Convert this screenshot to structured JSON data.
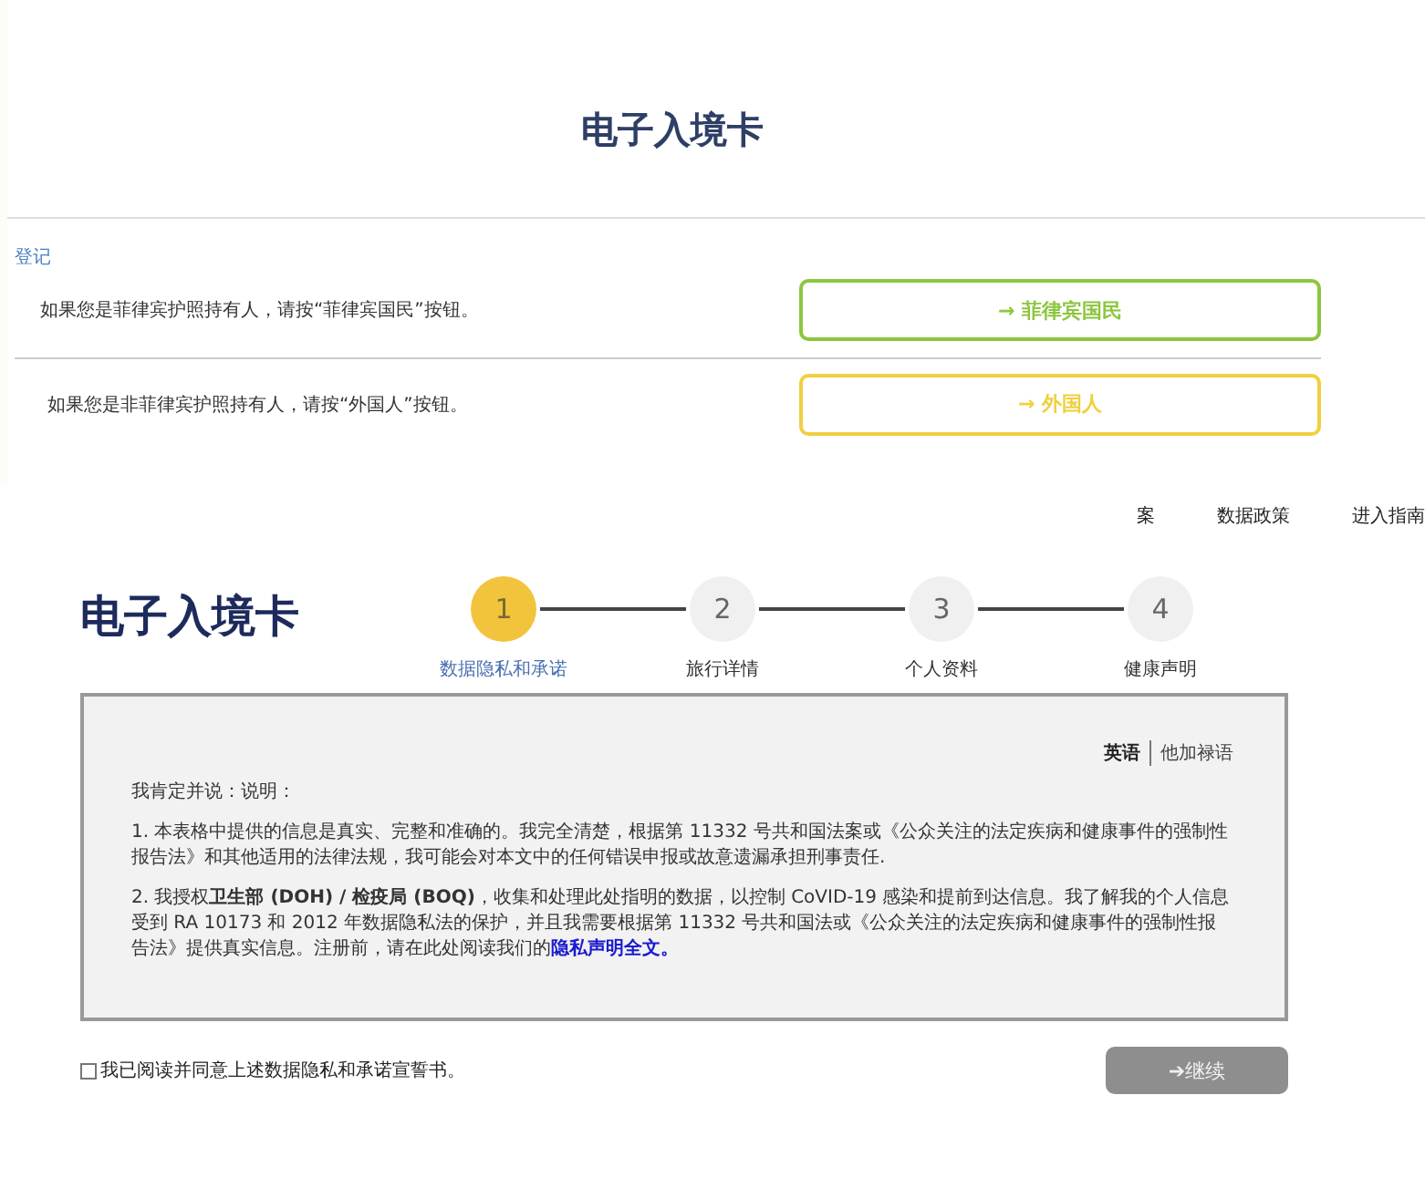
{
  "registration": {
    "title": "电子入境卡",
    "section_label": "登记",
    "options": [
      {
        "text": "如果您是菲律宾护照持有人，请按“菲律宾国民”按钮。",
        "button": "→ 菲律宾国民",
        "color": "#8cc63f"
      },
      {
        "text": "如果您是非菲律宾护照持有人，请按“外国人”按钮。",
        "button": "→ 外国人",
        "color": "#f0d040"
      }
    ]
  },
  "form": {
    "nav": [
      "案",
      "数据政策",
      "进入指南"
    ],
    "title": "电子入境卡",
    "steps": [
      {
        "number": "1",
        "label": "数据隐私和承诺",
        "selected": true
      },
      {
        "number": "2",
        "label": "旅行详情",
        "selected": false
      },
      {
        "number": "3",
        "label": "个人资料",
        "selected": false
      },
      {
        "number": "4",
        "label": "健康声明",
        "selected": false
      }
    ],
    "languages": [
      {
        "label": "英语",
        "selected": true
      },
      {
        "label": "他加禄语",
        "selected": false
      }
    ],
    "intro": "我肯定并说：说明：",
    "paragraphs": [
      {
        "text": "1. 本表格中提供的信息是真实、完整和准确的。我完全清楚，根据第 11332 号共和国法案或《公众关注的法定疾病和健康事件的强制性报告法》和其他适用的法律法规，我可能会对本文中的任何错误申报或故意遗漏承担刑事责任."
      },
      {
        "text": "2. 我授权**卫生部 (DOH) / 检疫局 (BOQ)**，收集和处理此处指明的数据，以控制 CoVID-19 感染和提前到达信息。我了解我的个人信息受到 RA 10173 和 2012 年数据隐私法的保护，并且我需要根据第 11332 号共和国法或《公众关注的法定疾病和健康事件的强制性报告法》提供真实信息。注册前，请在此处阅读我们的",
        "link": "隐私声明全文。"
      }
    ],
    "agreement": {
      "label": "我已阅读并同意上述数据隐私和承诺宣誓书。",
      "checked": false
    },
    "continue_button": {
      "label": "➔继续",
      "disabled": true
    }
  }
}
